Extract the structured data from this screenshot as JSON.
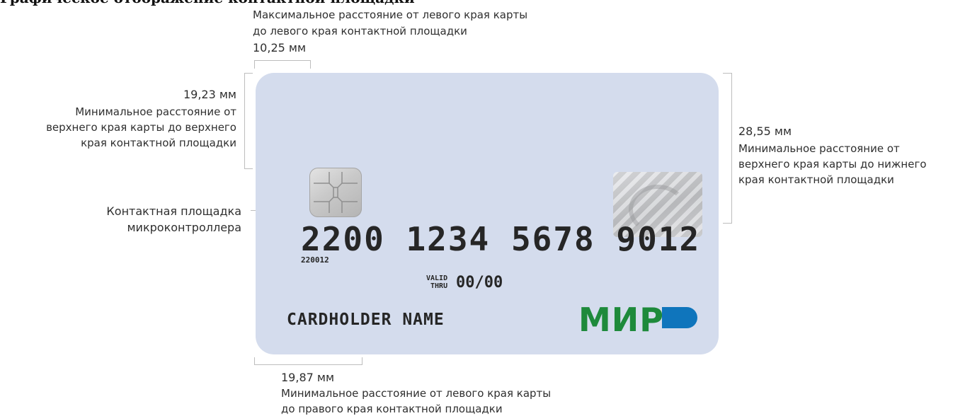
{
  "header": {
    "title": "Графическое отображение контактной площадки"
  },
  "annotations": {
    "top_left": {
      "line1": "Максимальное расстояние от левого края карты",
      "line2": "до левого края контактной площадки",
      "value": "10,25 мм"
    },
    "left_top": {
      "value": "19,23 мм",
      "line1": "Минимальное расстояние от",
      "line2": "верхнего края карты до верхнего",
      "line3": "края контактной площадки"
    },
    "chip_label": {
      "line1": "Контактная площадка",
      "line2": "микроконтроллера"
    },
    "right": {
      "value": "28,55 мм",
      "line1": "Минимальное расстояние от",
      "line2": "верхнего края карты до нижнего",
      "line3": "края контактной площадки"
    },
    "bottom": {
      "value": "19,87 мм",
      "line1": "Минимальное расстояние от левого края карты",
      "line2": "до правого края контактной площадки"
    }
  },
  "card": {
    "number": "2200 1234 5678 9012",
    "bin": "220012",
    "valid_label_1": "VALID",
    "valid_label_2": "THRU",
    "expiry": "00/00",
    "holder": "CARDHOLDER NAME",
    "logo_text": "МИР",
    "colors": {
      "card": "#d4dced",
      "logo_green": "#1e8a3b",
      "logo_blue": "#0f75bc"
    },
    "icons": [
      "chip-icon",
      "hologram-icon",
      "mir-logo-icon"
    ]
  }
}
